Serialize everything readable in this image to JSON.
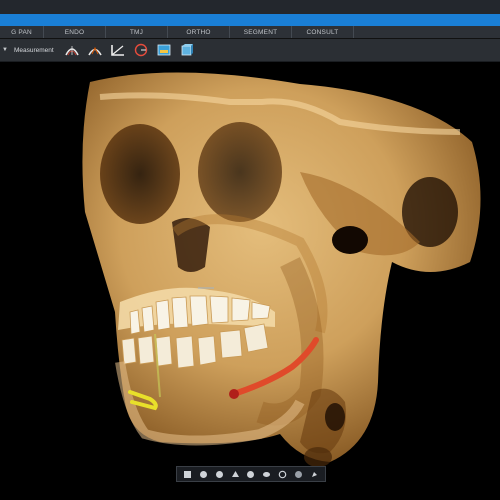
{
  "tabs": [
    "G PAN",
    "ENDO",
    "TMJ",
    "ORTHO",
    "SEGMENT",
    "CONSULT"
  ],
  "toolbar": {
    "dropdown_label": "Measurement",
    "tool_icons": [
      "mandible-curve-icon",
      "jaw-arch-icon",
      "angle-measure-icon",
      "protractor-icon",
      "image-panel-icon",
      "volume-cube-icon"
    ]
  },
  "bottom_toolbar": {
    "icons": [
      "view-front-icon",
      "view-left-icon",
      "view-right-icon",
      "view-top-icon",
      "view-back-icon",
      "view-bottom-icon",
      "rotate-icon",
      "reset-view-icon",
      "clip-icon"
    ]
  },
  "colors": {
    "accent": "#1a7fd6",
    "bone": "#d9a860",
    "nerve_canal_left": "#e04a2a",
    "nerve_canal_right": "#e8e02a"
  }
}
